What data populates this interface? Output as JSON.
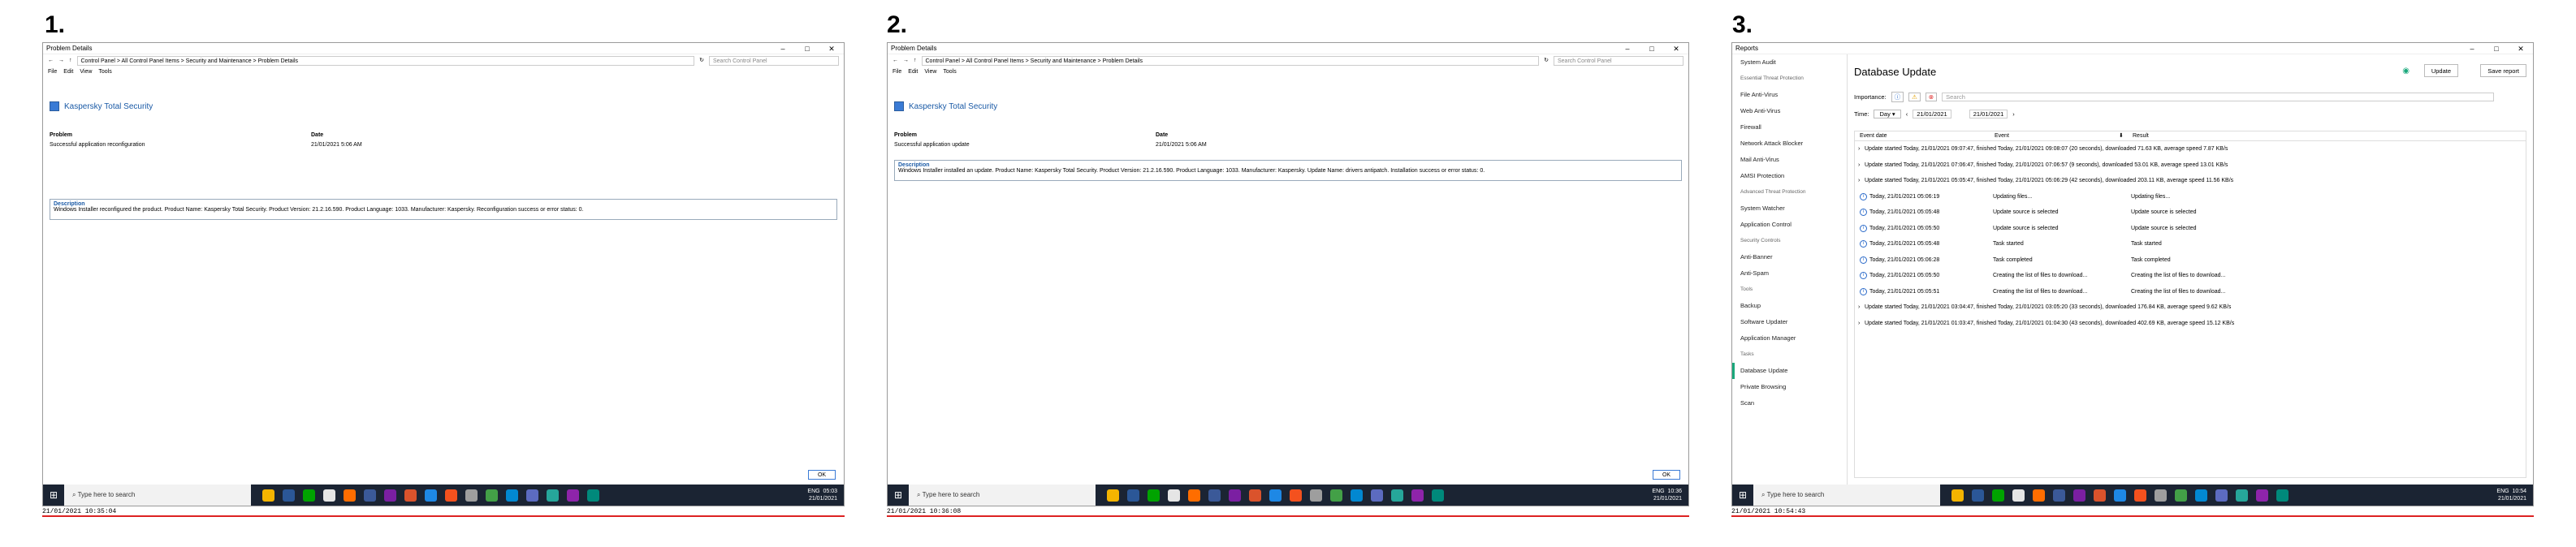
{
  "panels": [
    {
      "num": "1.",
      "window_title": "Problem Details",
      "address": "Control Panel  >  All Control Panel Items  >  Security and Maintenance  >  Problem Details",
      "search_placeholder": "Search Control Panel",
      "menu": [
        "File",
        "Edit",
        "View",
        "Tools"
      ],
      "product": "Kaspersky Total Security",
      "problem_label": "Problem",
      "problem_value": "Successful application reconfiguration",
      "date_label": "Date",
      "date_value": "21/01/2021 5:06 AM",
      "description_label": "Description",
      "description": "Windows Installer reconfigured the product. Product Name: Kaspersky Total Security. Product Version: 21.2.16.590. Product Language: 1033. Manufacturer: Kaspersky. Reconfiguration success or error status: 0.",
      "ok": "OK",
      "taskbar_search": "Type here to search",
      "tray_lang": "ENG",
      "tray_time": "05:03",
      "tray_date": "21/01/2021",
      "caption": "21/01/2021 10:35:04"
    },
    {
      "num": "2.",
      "window_title": "Problem Details",
      "address": "Control Panel  >  All Control Panel Items  >  Security and Maintenance  >  Problem Details",
      "search_placeholder": "Search Control Panel",
      "menu": [
        "File",
        "Edit",
        "View",
        "Tools"
      ],
      "product": "Kaspersky Total Security",
      "problem_label": "Problem",
      "problem_value": "Successful application update",
      "date_label": "Date",
      "date_value": "21/01/2021 5:06 AM",
      "description_label": "Description",
      "description": "Windows Installer installed an update. Product Name: Kaspersky Total Security. Product Version: 21.2.16.590. Product Language: 1033. Manufacturer: Kaspersky. Update Name: drivers antipatch. Installation success or error status: 0.",
      "ok": "OK",
      "taskbar_search": "Type here to search",
      "tray_lang": "ENG",
      "tray_time": "10:36",
      "tray_date": "21/01/2021",
      "caption": "21/01/2021 10:36:08"
    }
  ],
  "reports": {
    "num": "3.",
    "window_title": "Reports",
    "sidebar": [
      {
        "type": "item",
        "label": "System Audit"
      },
      {
        "type": "hdr",
        "label": "Essential Threat Protection"
      },
      {
        "type": "item",
        "label": "File Anti-Virus"
      },
      {
        "type": "item",
        "label": "Web Anti-Virus"
      },
      {
        "type": "item",
        "label": "Firewall"
      },
      {
        "type": "item",
        "label": "Network Attack Blocker"
      },
      {
        "type": "item",
        "label": "Mail Anti-Virus"
      },
      {
        "type": "item",
        "label": "AMSI Protection"
      },
      {
        "type": "hdr",
        "label": "Advanced Threat Protection"
      },
      {
        "type": "item",
        "label": "System Watcher"
      },
      {
        "type": "item",
        "label": "Application Control"
      },
      {
        "type": "hdr",
        "label": "Security Controls"
      },
      {
        "type": "item",
        "label": "Anti-Banner"
      },
      {
        "type": "item",
        "label": "Anti-Spam"
      },
      {
        "type": "hdr",
        "label": "Tools"
      },
      {
        "type": "item",
        "label": "Backup"
      },
      {
        "type": "item",
        "label": "Software Updater"
      },
      {
        "type": "item",
        "label": "Application Manager"
      },
      {
        "type": "hdr",
        "label": "Tasks"
      },
      {
        "type": "item",
        "label": "Database Update",
        "active": true
      },
      {
        "type": "item",
        "label": "Private Browsing"
      },
      {
        "type": "item",
        "label": "Scan"
      }
    ],
    "title": "Database Update",
    "update_button": "Update",
    "save_button": "Save report",
    "importance_label": "Importance:",
    "search_placeholder": "Search",
    "time_label": "Time:",
    "time_period": "Day",
    "date_from": "21/01/2021",
    "date_to": "21/01/2021",
    "columns": [
      "Event date",
      "Event",
      "Result"
    ],
    "rows": [
      {
        "kind": "summary",
        "text": "Update started Today, 21/01/2021 09:07:47, finished Today, 21/01/2021 09:08:07 (20 seconds), downloaded 71.63 KB, average speed 7.87 KB/s"
      },
      {
        "kind": "summary",
        "text": "Update started Today, 21/01/2021 07:06:47, finished Today, 21/01/2021 07:06:57 (9 seconds), downloaded 53.01 KB, average speed 13.01 KB/s"
      },
      {
        "kind": "summary",
        "text": "Update started Today, 21/01/2021 05:05:47, finished Today, 21/01/2021 05:06:29 (42 seconds), downloaded 203.11 KB, average speed 11.56 KB/s"
      },
      {
        "kind": "detail",
        "date": "Today, 21/01/2021 05:06:19",
        "event": "Updating files...",
        "result": "Updating files..."
      },
      {
        "kind": "detail",
        "date": "Today, 21/01/2021 05:05:48",
        "event": "Update source is selected",
        "result": "Update source is selected"
      },
      {
        "kind": "detail",
        "date": "Today, 21/01/2021 05:05:50",
        "event": "Update source is selected",
        "result": "Update source is selected"
      },
      {
        "kind": "detail",
        "date": "Today, 21/01/2021 05:05:48",
        "event": "Task started",
        "result": "Task started"
      },
      {
        "kind": "detail",
        "date": "Today, 21/01/2021 05:06:28",
        "event": "Task completed",
        "result": "Task completed"
      },
      {
        "kind": "detail",
        "date": "Today, 21/01/2021 05:05:50",
        "event": "Creating the list of files to download...",
        "result": "Creating the list of files to download..."
      },
      {
        "kind": "detail",
        "date": "Today, 21/01/2021 05:05:51",
        "event": "Creating the list of files to download...",
        "result": "Creating the list of files to download..."
      },
      {
        "kind": "summary",
        "text": "Update started Today, 21/01/2021 03:04:47, finished Today, 21/01/2021 03:05:20 (33 seconds), downloaded 176.84 KB, average speed 9.62 KB/s"
      },
      {
        "kind": "summary",
        "text": "Update started Today, 21/01/2021 01:03:47, finished Today, 21/01/2021 01:04:30 (43 seconds), downloaded 402.69 KB, average speed 15.12 KB/s"
      }
    ],
    "taskbar_search": "Type here to search",
    "tray_lang": "ENG",
    "tray_time": "10:54",
    "tray_date": "21/01/2021",
    "caption": "21/01/2021 10:54:43"
  },
  "colors": {
    "accent": "#1aa87c",
    "link": "#1a5aa6",
    "taskbar": "#1b2433",
    "caption_rule": "#dd2222"
  },
  "taskbar_icons": [
    "#f4b400",
    "#2b5797",
    "#00a300",
    "#e5e5e5",
    "#ff6d00",
    "#3b5998",
    "#7b1fa2",
    "#da532c",
    "#1e88e5",
    "#f4511e",
    "#9e9e9e",
    "#43a047",
    "#0288d1",
    "#5c6bc0",
    "#26a69a",
    "#8e24aa",
    "#00897b"
  ]
}
